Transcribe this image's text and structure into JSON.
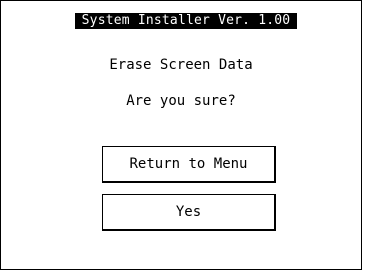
{
  "header": {
    "title": "System Installer  Ver. 1.00"
  },
  "dialog": {
    "action": "Erase Screen Data",
    "prompt": "Are you sure?"
  },
  "buttons": {
    "return_label": "Return to Menu",
    "yes_label": "Yes"
  },
  "colors": {
    "background": "#ffffff",
    "foreground": "#000000",
    "title_bar_bg": "#000000",
    "title_bar_fg": "#ffffff"
  }
}
